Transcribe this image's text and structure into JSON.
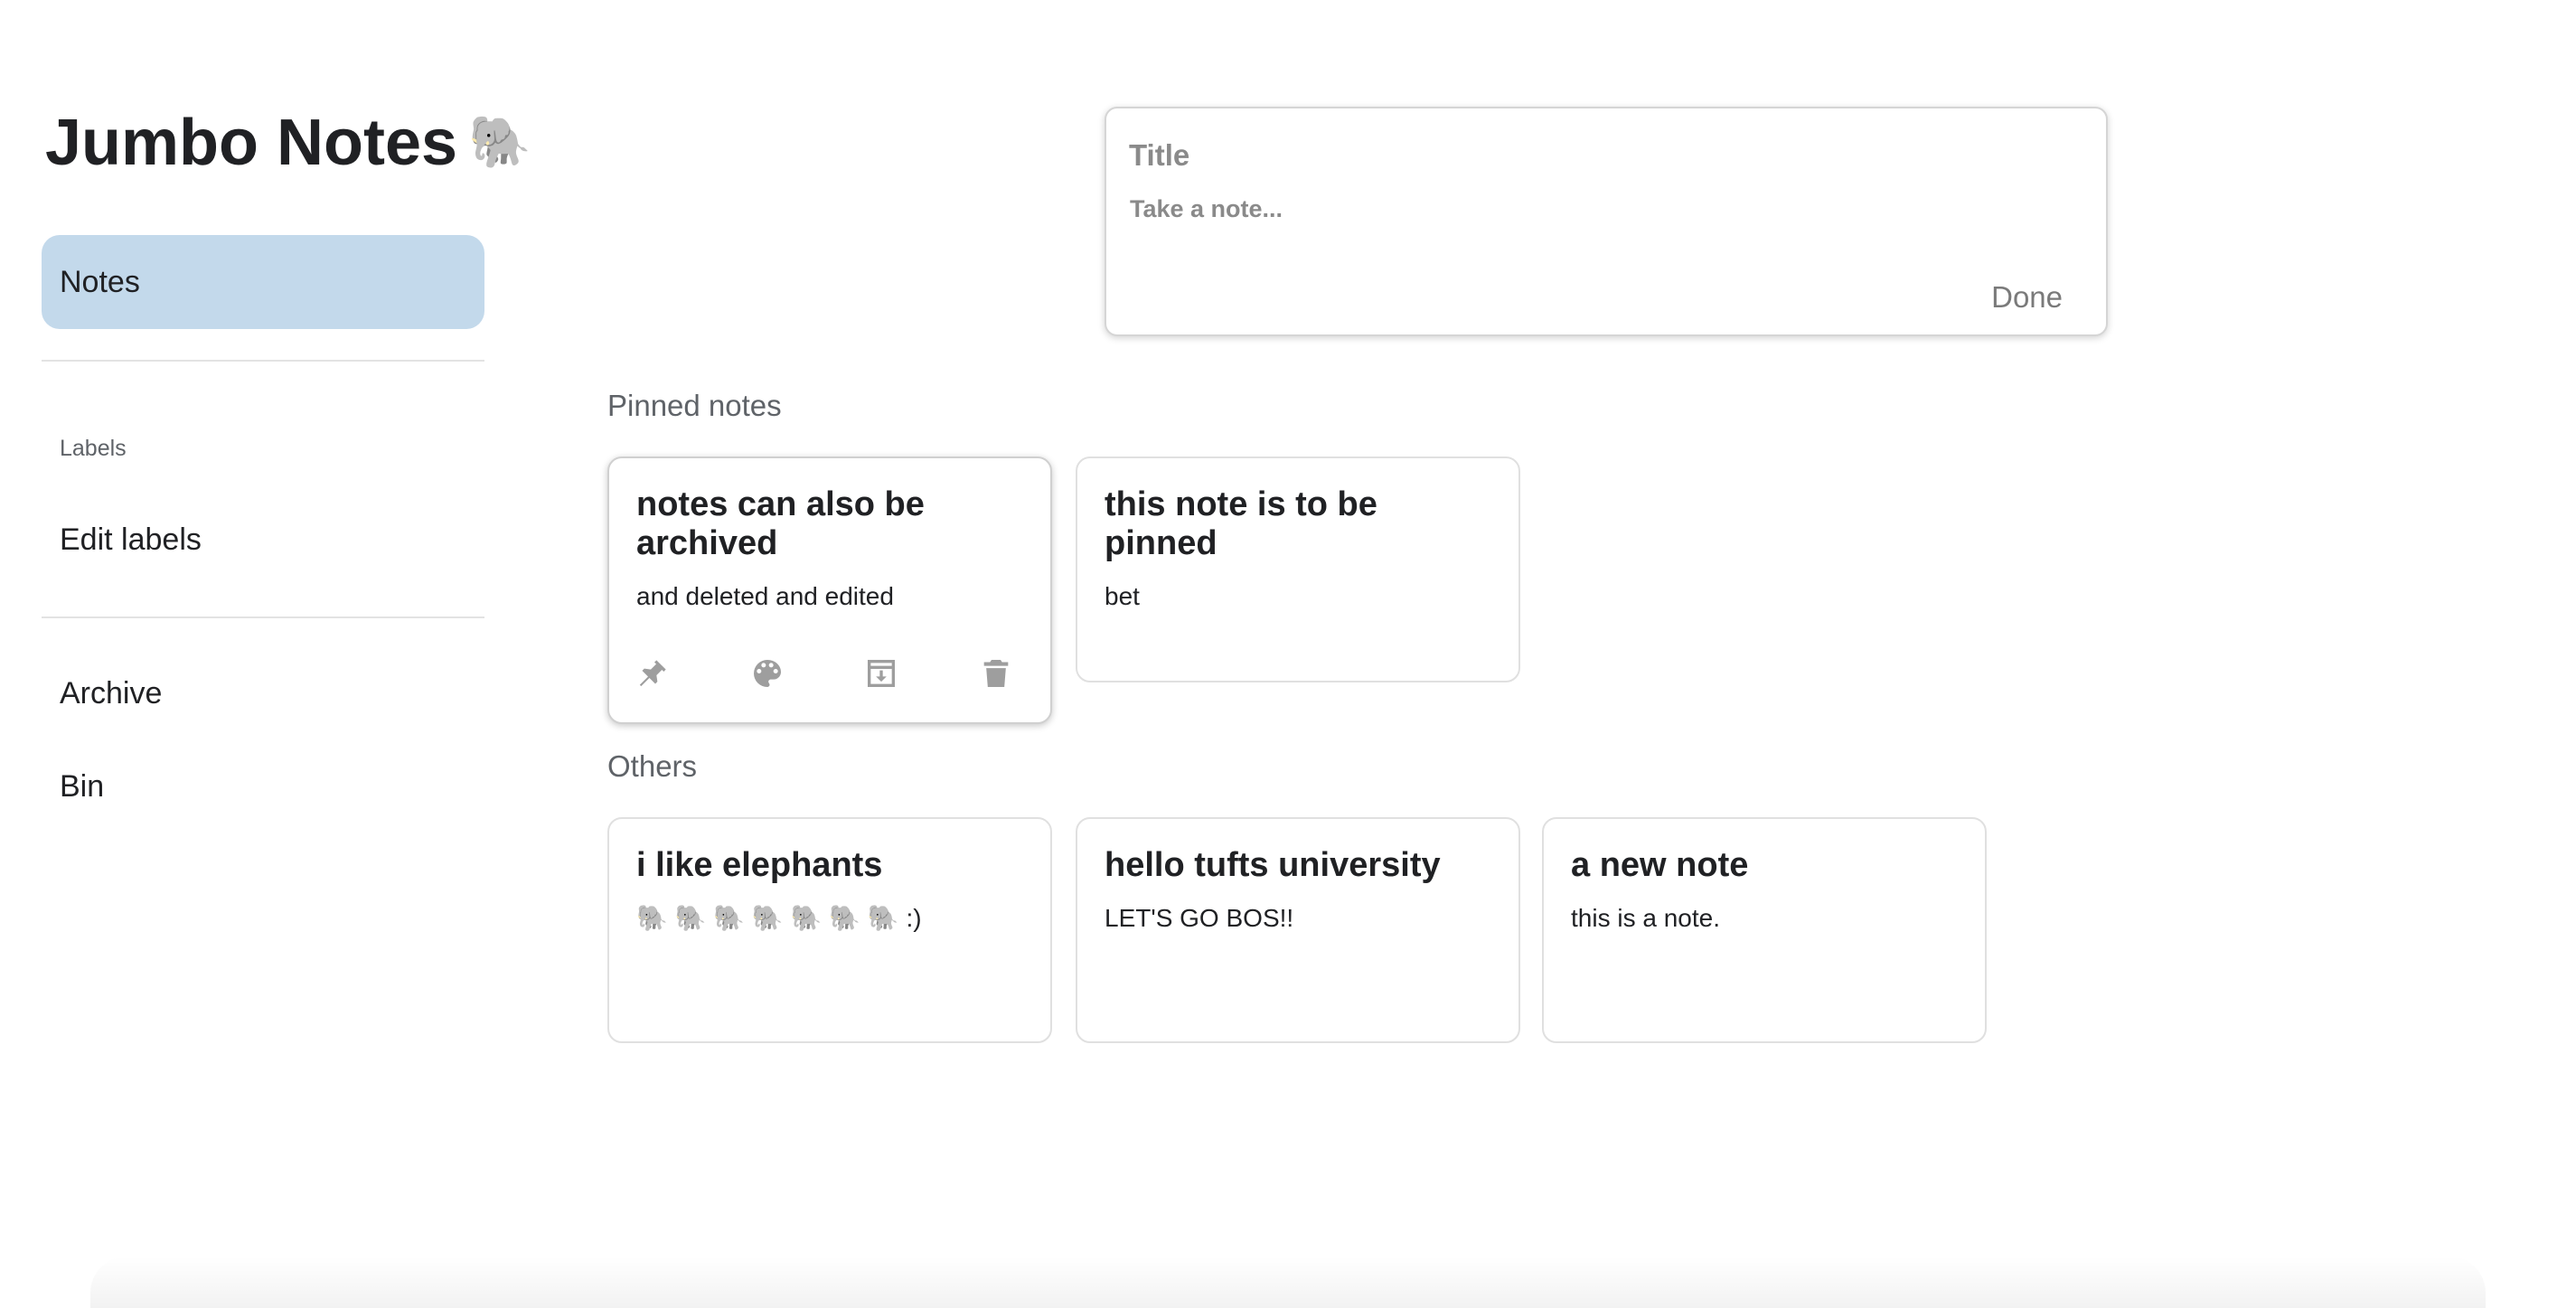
{
  "app": {
    "title": "Jumbo Notes",
    "title_emoji": "🐘"
  },
  "sidebar": {
    "notes_label": "Notes",
    "labels_caption": "Labels",
    "edit_labels_label": "Edit labels",
    "archive_label": "Archive",
    "bin_label": "Bin"
  },
  "composer": {
    "title_placeholder": "Title",
    "body_placeholder": "Take a note...",
    "title_value": "",
    "body_value": "",
    "done_label": "Done"
  },
  "pinned": {
    "heading": "Pinned notes",
    "notes": [
      {
        "title": "notes can also be archived",
        "body": "and deleted and edited"
      },
      {
        "title": "this note is to be pinned",
        "body": "bet"
      }
    ]
  },
  "others": {
    "heading": "Others",
    "notes": [
      {
        "title": "i like elephants",
        "body": "🐘 🐘 🐘 🐘 🐘 🐘 🐘 :)"
      },
      {
        "title": "hello tufts university",
        "body": "LET'S GO BOS!!"
      },
      {
        "title": "a new note",
        "body": "this is a note."
      }
    ]
  },
  "note_actions": [
    "pin-icon",
    "palette-icon",
    "archive-icon",
    "trash-icon"
  ],
  "colors": {
    "active_nav": "#c3d9eb",
    "icon_gray": "#9e9e9e",
    "muted_text": "#5f6368"
  }
}
